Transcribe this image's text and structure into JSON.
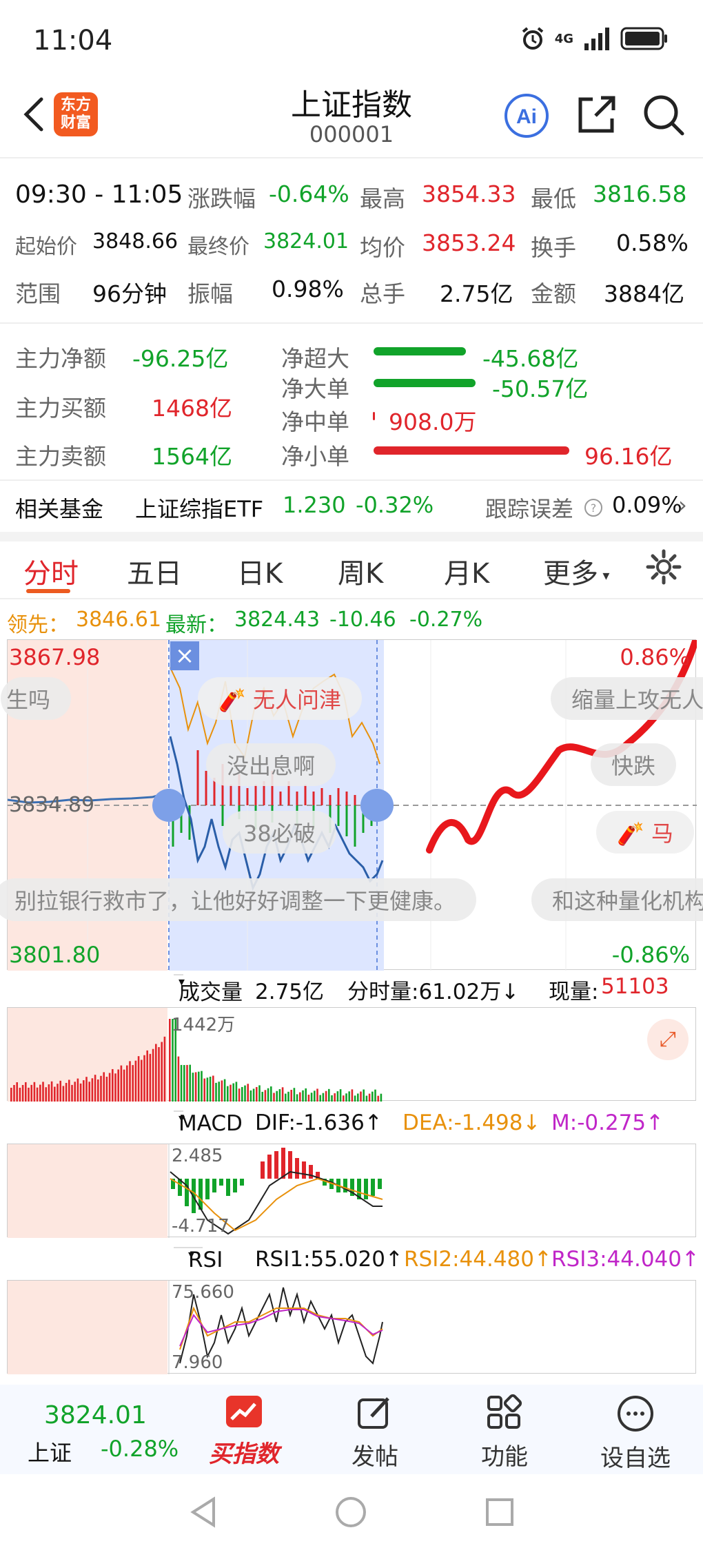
{
  "status": {
    "time": "11:04",
    "network": "4G"
  },
  "header": {
    "title": "上证指数",
    "code": "000001",
    "logo_text_1": "东方",
    "logo_text_2": "财富",
    "ai_label": "Ai"
  },
  "stats": {
    "time_range": "09:30 - 11:05",
    "change_pct_label": "涨跌幅",
    "change_pct": "-0.64%",
    "high_label": "最高",
    "high": "3854.33",
    "low_label": "最低",
    "low": "3816.58",
    "start_label": "起始价",
    "start": "3848.66",
    "end_label": "最终价",
    "end": "3824.01",
    "avg_label": "均价",
    "avg": "3853.24",
    "turnover_label": "换手",
    "turnover": "0.58%",
    "range_label": "范围",
    "range": "96分钟",
    "amplitude_label": "振幅",
    "amplitude": "0.98%",
    "volume_label": "总手",
    "volume": "2.75亿",
    "amount_label": "金额",
    "amount": "3884亿"
  },
  "flows": {
    "net_main_label": "主力净额",
    "net_main": "-96.25亿",
    "buy_main_label": "主力买额",
    "buy_main": "1468亿",
    "sell_main_label": "主力卖额",
    "sell_main": "1564亿",
    "super_label": "净超大",
    "super": "-45.68亿",
    "large_label": "净大单",
    "large": "-50.57亿",
    "medium_label": "净中单",
    "medium": "908.0万",
    "small_label": "净小单",
    "small": "96.16亿"
  },
  "fund": {
    "label": "相关基金",
    "name": "上证综指ETF",
    "price": "1.230",
    "change": "-0.32%",
    "track_label": "跟踪误差",
    "track": "0.09%"
  },
  "tabs": [
    "分时",
    "五日",
    "日K",
    "周K",
    "月K",
    "更多"
  ],
  "chart": {
    "lead_label": "领先：",
    "lead": "3846.61",
    "latest_label": "最新：",
    "latest": "3824.43",
    "latest_change": "-10.46",
    "latest_pct": "-0.27%",
    "ymax": "3867.98",
    "ymin": "3801.80",
    "ymid": "3834.89",
    "pmax": "0.86%",
    "pmin": "-0.86%",
    "bubbles": [
      "无人问津",
      "缩量上攻无人",
      "没出息啊",
      "快跌",
      "38必破",
      "马",
      "别拉银行救市了，让他好好调整一下更健康。",
      "和这种量化机构",
      "生吗"
    ],
    "colors": {
      "up": "#e0252b",
      "down": "#11a32a",
      "select": "#dbe6ff"
    }
  },
  "volume": {
    "label": "成交量",
    "total": "2.75亿",
    "tick_label": "分时量:61.02万↓",
    "now_label": "现量:",
    "now": "51103",
    "max": "1442万"
  },
  "macd": {
    "label": "MACD",
    "dif": "DIF:-1.636↑",
    "dea": "DEA:-1.498↓",
    "m": "M:-0.275↑",
    "max": "2.485",
    "min": "-4.717"
  },
  "rsi": {
    "label": "RSI",
    "rsi1": "RSI1:55.020↑",
    "rsi2": "RSI2:44.480↑",
    "rsi3": "RSI3:44.040↑",
    "max": "75.660",
    "min": "7.960"
  },
  "bottom": {
    "index_price": "3824.01",
    "index_name": "上证",
    "index_pct": "-0.28%",
    "buy": "买指数",
    "post": "发帖",
    "func": "功能",
    "fav": "设自选"
  }
}
